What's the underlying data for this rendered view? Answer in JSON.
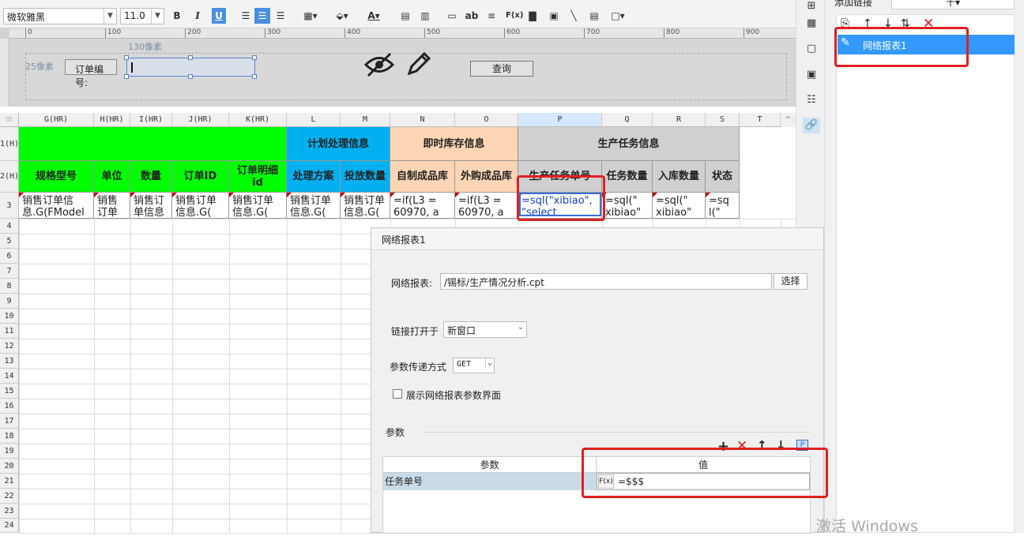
{
  "toolbar": {
    "font_name": "微软雅黑",
    "font_size": "11.0",
    "bold": "B",
    "italic": "I",
    "underline": "U",
    "text_color_glyph": "A",
    "ab_label": "ab",
    "fx_label": "F(x)"
  },
  "ruler": {
    "ticks": [
      "0",
      "100",
      "200",
      "300",
      "400",
      "500",
      "600",
      "700",
      "800",
      "900"
    ]
  },
  "form": {
    "px130_label": "130像素",
    "px25_label": "25像素",
    "order_no_label": "订单编号:",
    "query_button": "查询"
  },
  "sheet": {
    "columns": [
      "G(HR)",
      "H(HR)",
      "I(HR)",
      "J(HR)",
      "K(HR)",
      "L",
      "M",
      "N",
      "O",
      "P",
      "Q",
      "R",
      "S",
      "T"
    ],
    "rows": [
      "1(H)",
      "2(H)",
      "3",
      "4",
      "5",
      "6",
      "7",
      "8",
      "9",
      "10",
      "11",
      "12",
      "13",
      "14",
      "15",
      "16",
      "17",
      "18",
      "19",
      "20",
      "21",
      "22",
      "23",
      "24"
    ],
    "group_headers": {
      "plan": "计划处理信息",
      "stock": "即时库存信息",
      "task": "生产任务信息"
    },
    "header_row": [
      "规格型号",
      "单位",
      "数量",
      "订单ID",
      "订单明细\nid",
      "处理方案",
      "投放数量",
      "自制成品库",
      "外购成品库",
      "生产任务单号",
      "任务数量",
      "入库数量",
      "状态"
    ],
    "data_row": [
      "销售订单信\n息.G(FModel",
      "销售\n订单",
      "销售订\n单信息",
      "销售订单\n信息.G(",
      "销售订单\n信息.G(",
      "销售订单\n信息.G(",
      "销售订单\n信息.G(",
      "=if(L3 =\n60970, a",
      "=if(L3 =\n60970, a",
      "=sql(\"xibiao\",\n\"select",
      "=sql(\"\nxibiao\"",
      "=sql(\"\nxibiao\"",
      "=sq\nl(\""
    ]
  },
  "side_panel": {
    "title": "添加链接",
    "plus": "十",
    "link_item": "网络报表1"
  },
  "dialog": {
    "title": "网络报表1",
    "report_label": "网络报表:",
    "report_value": "/锡标/生产情况分析.cpt",
    "choose_button": "选择",
    "open_in_label": "链接打开于",
    "open_in_value": "新窗口",
    "method_label": "参数传递方式",
    "method_value": "GET",
    "show_params_label": "展示网络报表参数界面",
    "params_section": "参数",
    "param_col_header": "参数",
    "value_col_header": "值",
    "param_name": "任务单号",
    "param_value": "=$$$",
    "fx": "F(x)"
  },
  "watermark": "激活 Windows",
  "colors": {
    "green": "#00ff00",
    "cyan": "#00b0f0",
    "orange": "#fcd5b4",
    "gray": "#d0d0d0",
    "red_box": "#e02020",
    "selected": "#3399ff"
  }
}
